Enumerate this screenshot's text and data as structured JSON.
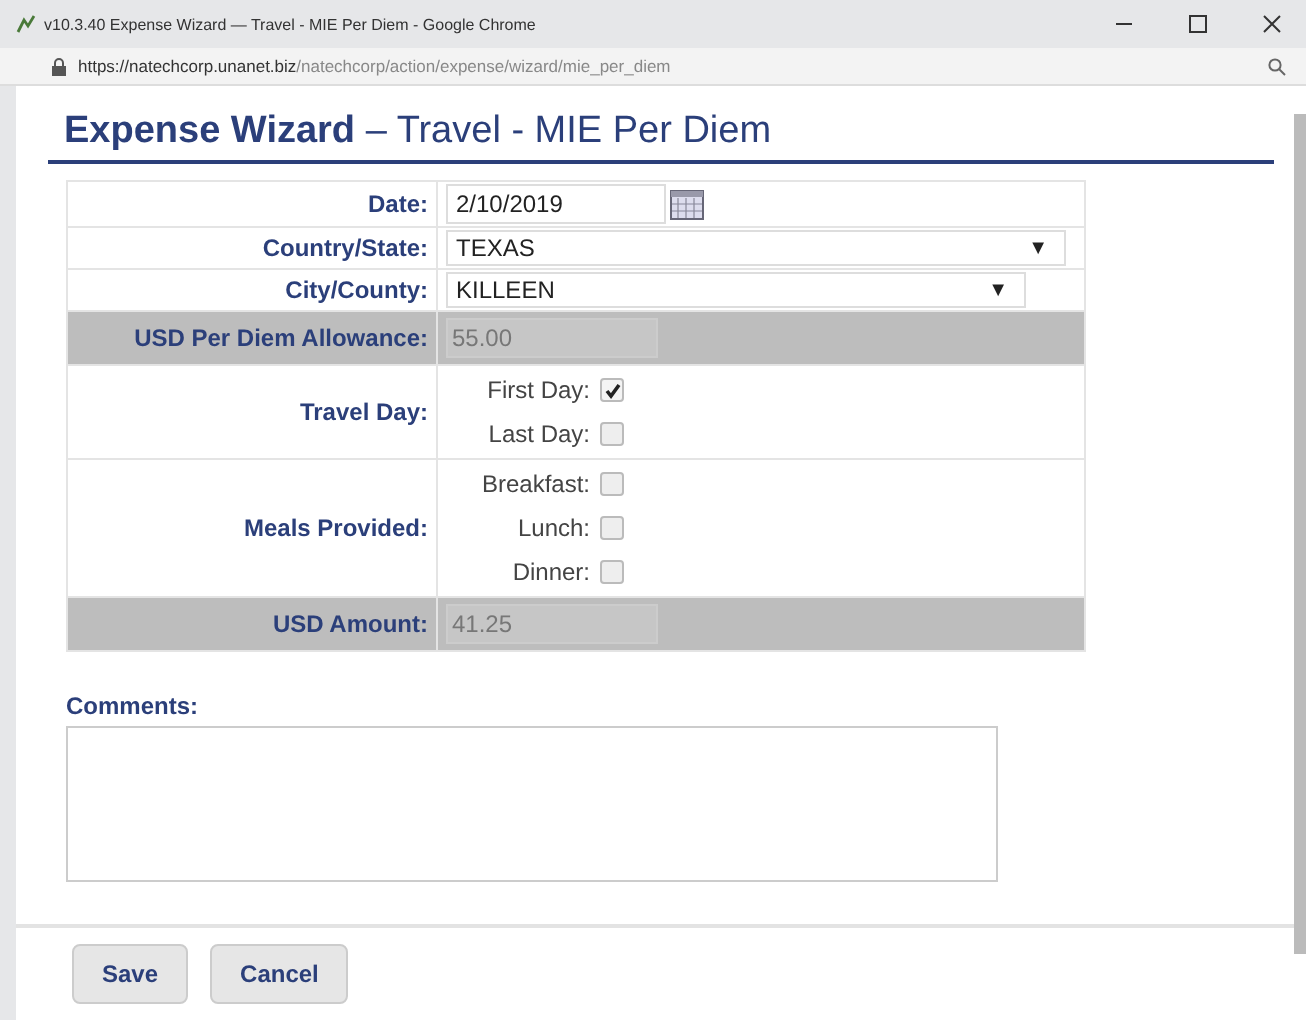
{
  "window": {
    "title": "v10.3.40 Expense Wizard — Travel - MIE Per Diem - Google Chrome"
  },
  "address_bar": {
    "host": "https://natechcorp.unanet.biz",
    "path": "/natechcorp/action/expense/wizard/mie_per_diem"
  },
  "heading": {
    "title": "Expense Wizard",
    "subtitle": "– Travel - MIE Per Diem"
  },
  "form": {
    "rows": [
      {
        "kind": "date",
        "label": "Date:",
        "value": "2/10/2019"
      },
      {
        "kind": "select",
        "label": "Country/State:",
        "value": "TEXAS",
        "arrow": "▼"
      },
      {
        "kind": "select",
        "label": "City/County:",
        "value": "KILLEEN",
        "arrow": "▼"
      },
      {
        "kind": "readonly",
        "label": "USD Per Diem Allowance:",
        "value": "55.00",
        "disabled": true
      },
      {
        "kind": "checks",
        "label": "Travel Day:",
        "items": [
          {
            "label": "First Day:",
            "checked": true
          },
          {
            "label": "Last Day:",
            "checked": false
          }
        ]
      },
      {
        "kind": "checks",
        "label": "Meals Provided:",
        "items": [
          {
            "label": "Breakfast:",
            "checked": false
          },
          {
            "label": "Lunch:",
            "checked": false
          },
          {
            "label": "Dinner:",
            "checked": false
          }
        ]
      },
      {
        "kind": "readonly",
        "label": "USD Amount:",
        "value": "41.25",
        "disabled": true
      }
    ]
  },
  "comments": {
    "label": "Comments:"
  },
  "buttons": [
    "Save",
    "Cancel"
  ]
}
